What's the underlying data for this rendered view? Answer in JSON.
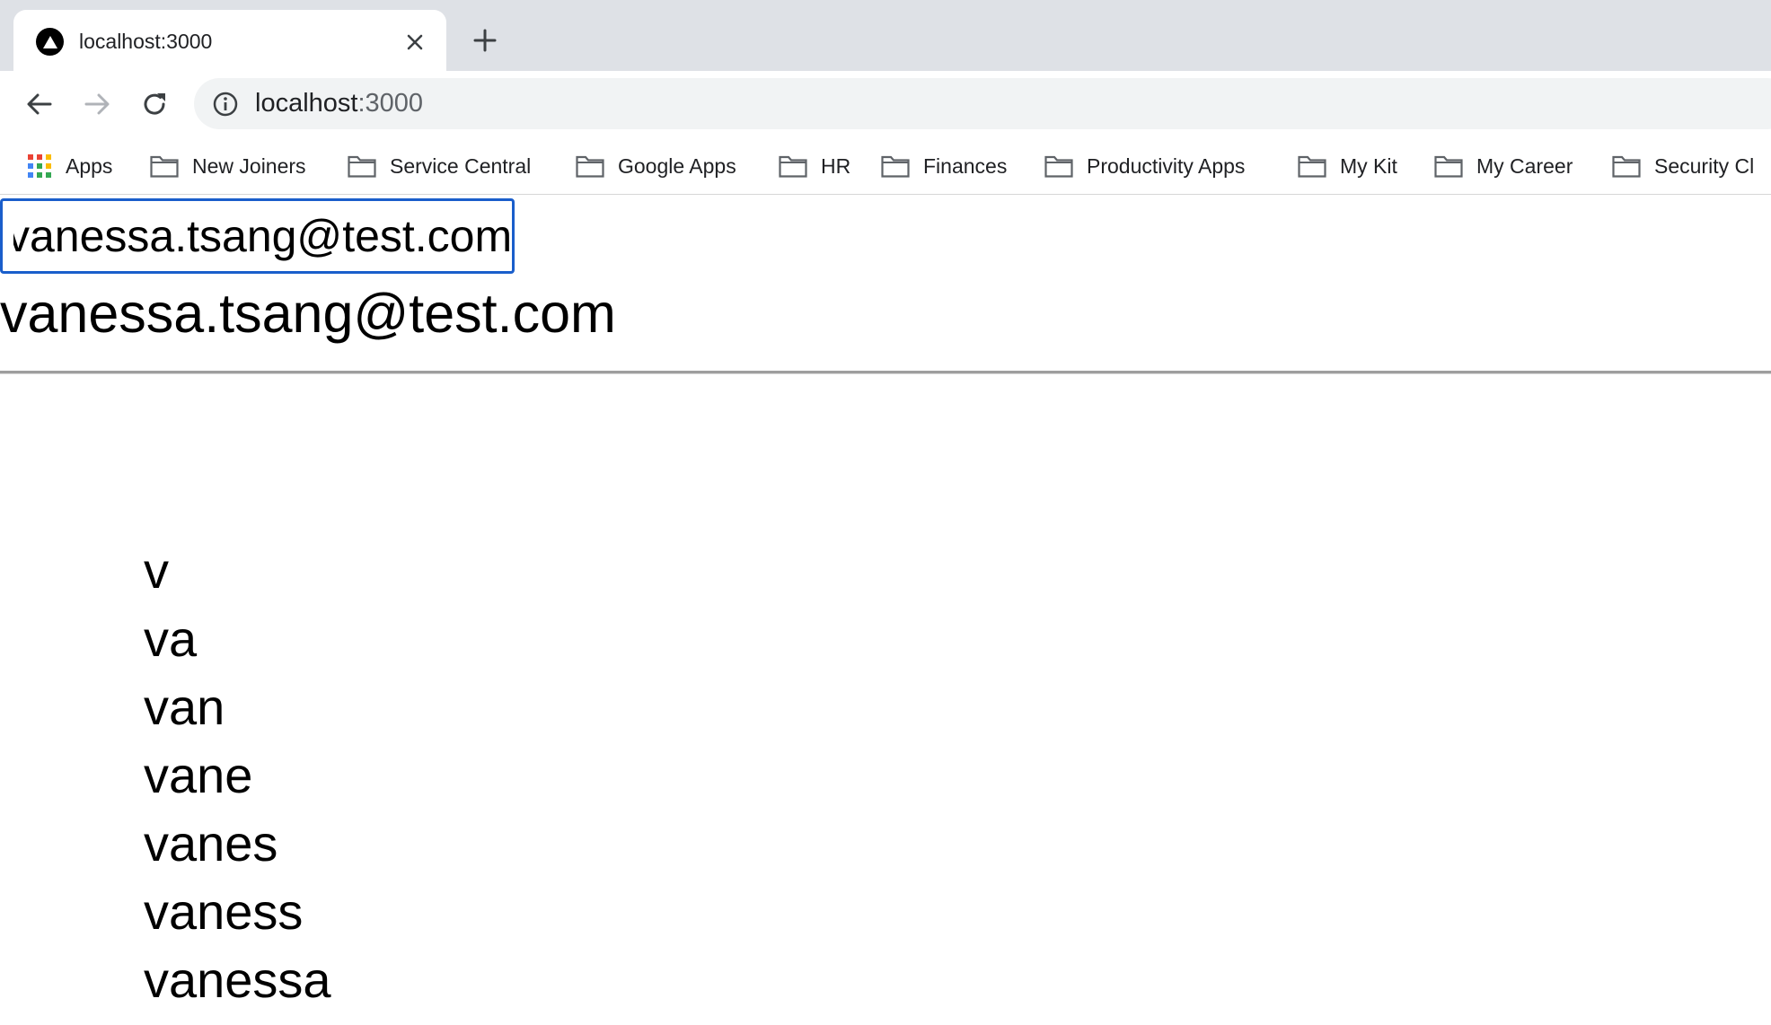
{
  "browser": {
    "tab": {
      "title": "localhost:3000"
    },
    "address_bar": {
      "host": "localhost",
      "port": ":3000"
    },
    "bookmarks": [
      {
        "label": "Apps",
        "icon": "apps-grid-icon"
      },
      {
        "label": "New Joiners",
        "icon": "folder-icon"
      },
      {
        "label": "Service Central",
        "icon": "folder-icon"
      },
      {
        "label": "Google Apps",
        "icon": "folder-icon"
      },
      {
        "label": "HR",
        "icon": "folder-icon"
      },
      {
        "label": "Finances",
        "icon": "folder-icon"
      },
      {
        "label": "Productivity Apps",
        "icon": "folder-icon"
      },
      {
        "label": "My Kit",
        "icon": "folder-icon"
      },
      {
        "label": "My Career",
        "icon": "folder-icon"
      },
      {
        "label": "Security Cl",
        "icon": "folder-icon"
      }
    ]
  },
  "page": {
    "email_input": {
      "value": "vanessa.tsang@test.com",
      "visible_text": "nessa.tsang@test.com"
    },
    "echo_text": "vanessa.tsang@test.com",
    "prefixes": [
      "v",
      "va",
      "van",
      "vane",
      "vanes",
      "vaness",
      "vanessa"
    ]
  },
  "colors": {
    "input_focus_border": "#1a5ecb",
    "tabstrip": "#dee1e6",
    "omnibox": "#f1f3f4"
  }
}
